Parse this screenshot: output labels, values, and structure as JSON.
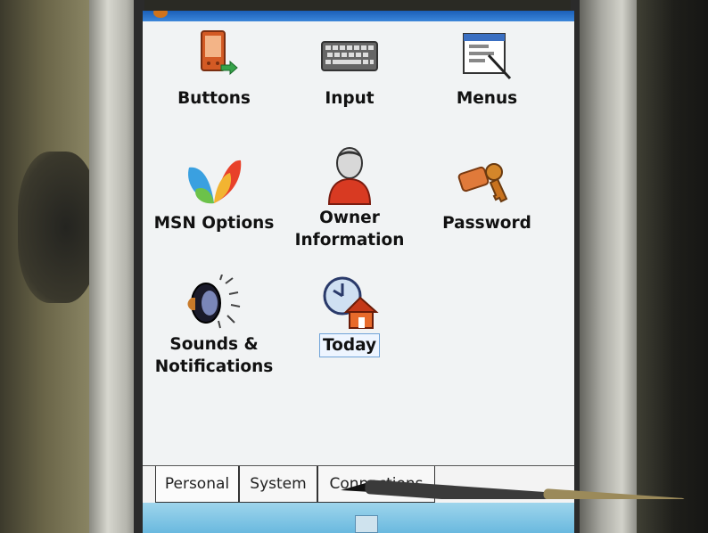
{
  "settings_tiles": [
    {
      "label": "Buttons",
      "icon": "pda-buttons-icon"
    },
    {
      "label": "Input",
      "icon": "keyboard-icon"
    },
    {
      "label": "Menus",
      "icon": "menu-window-icon"
    },
    {
      "label_line1": "MSN Options",
      "icon": "msn-butterfly-icon"
    },
    {
      "label_line1": "Owner",
      "label_line2": "Information",
      "icon": "person-icon"
    },
    {
      "label": "Password",
      "icon": "keys-icon"
    },
    {
      "label_line1": "Sounds &",
      "label_line2": "Notifications",
      "icon": "speaker-icon"
    },
    {
      "label": "Today",
      "icon": "clock-house-icon"
    }
  ],
  "selected_tile": "Today",
  "tabs": [
    {
      "label": "Personal",
      "active": true
    },
    {
      "label": "System",
      "active": false
    },
    {
      "label": "Connections",
      "active": false
    }
  ],
  "colors": {
    "screen_background": "#f1f3f4",
    "title_bar": "#1b5fb8",
    "bottom_bar": "#8ccbe8",
    "selection_border": "#6fa3d8"
  }
}
